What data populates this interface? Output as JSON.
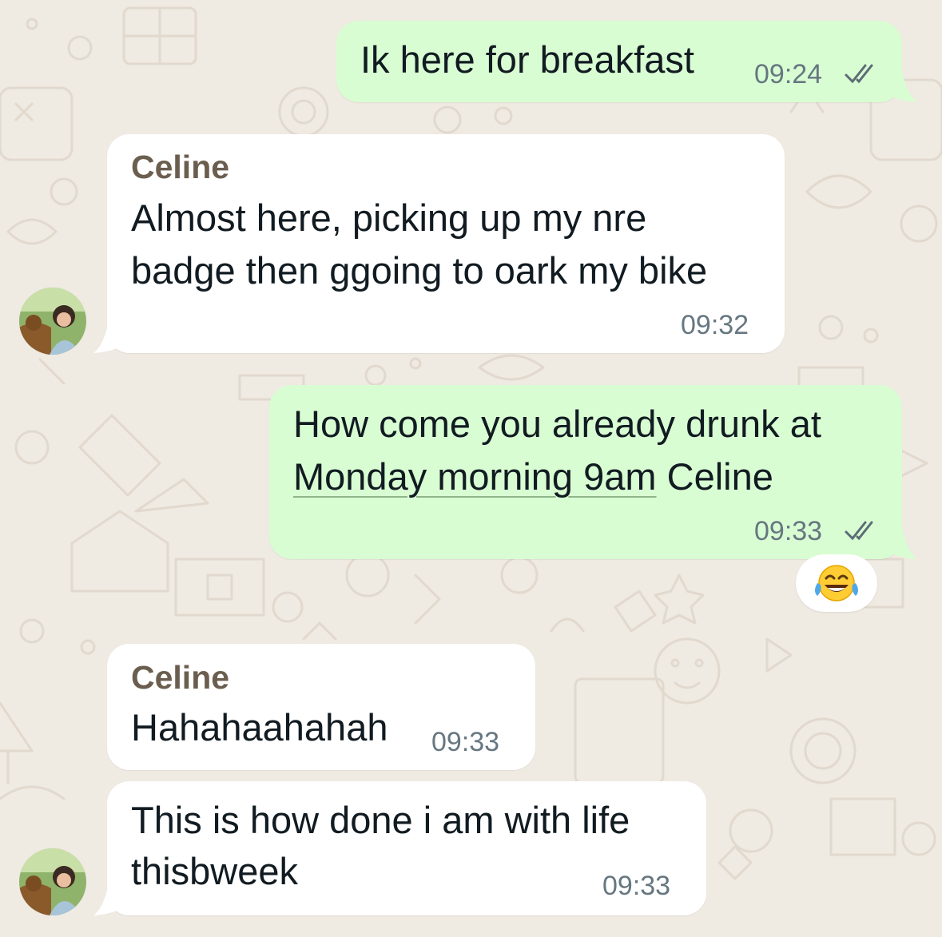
{
  "chat": {
    "messages": [
      {
        "direction": "outgoing",
        "text": "Ik here for breakfast",
        "time": "09:24",
        "status": "read-double-check"
      },
      {
        "direction": "incoming",
        "sender": "Celine",
        "lines": [
          "Almost here, picking up my nre",
          "badge then ggoing to oark my bike"
        ],
        "time": "09:32"
      },
      {
        "direction": "outgoing",
        "line1": "How come you already drunk at",
        "link": "Monday morning 9am",
        "line2_rest": " Celine",
        "time": "09:33",
        "status": "read-double-check",
        "reaction": "😂"
      },
      {
        "direction": "incoming",
        "sender": "Celine",
        "text": "Hahahaahahah",
        "time": "09:33"
      },
      {
        "direction": "incoming",
        "lines": [
          "This is how done i am with life",
          "thisbweek"
        ],
        "time": "09:33"
      }
    ]
  },
  "colors": {
    "wallpaper": "#efeae2",
    "outgoing_bubble": "#d9fdd3",
    "incoming_bubble": "#ffffff",
    "sender_name": "#6b5e4f",
    "timestamp": "#667781"
  },
  "icons": {
    "read_receipt": "double-check-icon",
    "reaction": "tears-of-joy-emoji"
  }
}
